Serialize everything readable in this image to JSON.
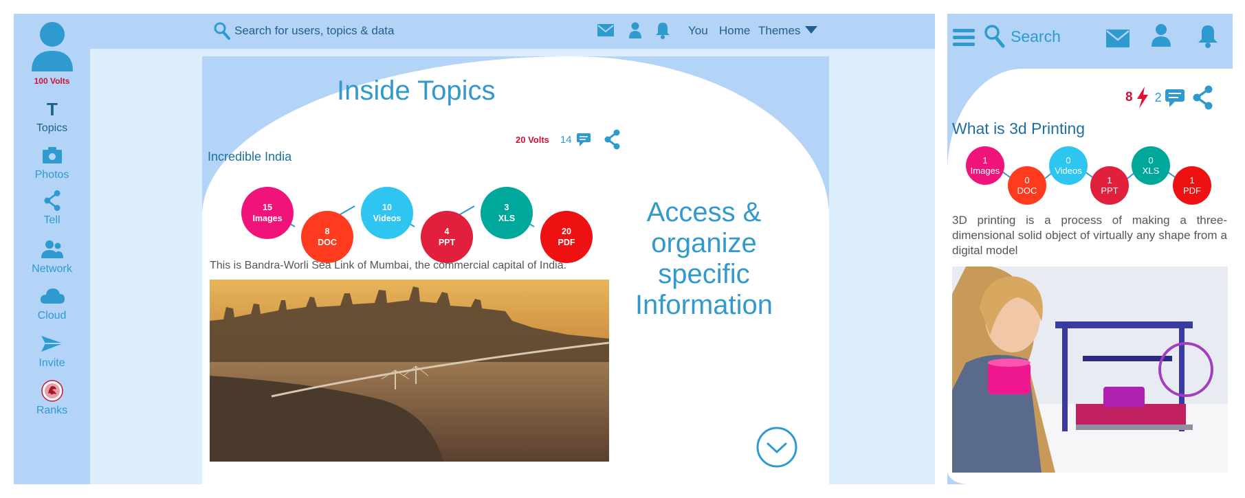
{
  "sidebar": {
    "user_volts": "100 Volts",
    "items": [
      {
        "label": "Topics",
        "icon": "topics-icon"
      },
      {
        "label": "Photos",
        "icon": "camera-icon"
      },
      {
        "label": "Tell",
        "icon": "share-icon"
      },
      {
        "label": "Network",
        "icon": "network-icon"
      },
      {
        "label": "Cloud",
        "icon": "cloud-icon"
      },
      {
        "label": "Invite",
        "icon": "paper-plane-icon"
      },
      {
        "label": "Ranks",
        "icon": "ranks-badge-icon"
      }
    ]
  },
  "topbar": {
    "search_placeholder": "Search for users, topics & data",
    "links": [
      "You",
      "Home",
      "Themes"
    ]
  },
  "main": {
    "title": "Inside Topics",
    "stats": {
      "volts": "20 Volts",
      "comments": "14"
    },
    "topic_title": "Incredible India",
    "bubbles": [
      {
        "count": "15",
        "label": "Images",
        "color": "#f0147a"
      },
      {
        "count": "8",
        "label": "DOC",
        "color": "#ff3b1f"
      },
      {
        "count": "10",
        "label": "Videos",
        "color": "#2ec6f0"
      },
      {
        "count": "4",
        "label": "PPT",
        "color": "#e0203c"
      },
      {
        "count": "3",
        "label": "XLS",
        "color": "#00a89c"
      },
      {
        "count": "20",
        "label": "PDF",
        "color": "#ee1111"
      }
    ],
    "caption": "This is Bandra-Worli Sea Link of Mumbai, the commercial capital of India.",
    "side_text": "Access & organize specific Information"
  },
  "mobile": {
    "search_label": "Search",
    "stats": {
      "volts": "8",
      "comments": "2"
    },
    "title": "What is 3d Printing",
    "bubbles": [
      {
        "count": "1",
        "label": "Images",
        "color": "#f0147a"
      },
      {
        "count": "0",
        "label": "DOC",
        "color": "#ff3b1f"
      },
      {
        "count": "0",
        "label": "Videos",
        "color": "#2ec6f0"
      },
      {
        "count": "1",
        "label": "PPT",
        "color": "#e0203c"
      },
      {
        "count": "0",
        "label": "XLS",
        "color": "#00a89c"
      },
      {
        "count": "1",
        "label": "PDF",
        "color": "#ee1111"
      }
    ],
    "description": "3D printing is a process of making a three-dimensional solid object of virtually any shape from a digital model"
  },
  "colors": {
    "accent": "#2e9ad0",
    "frame": "#b3d4f7",
    "volts": "#cc1133"
  }
}
